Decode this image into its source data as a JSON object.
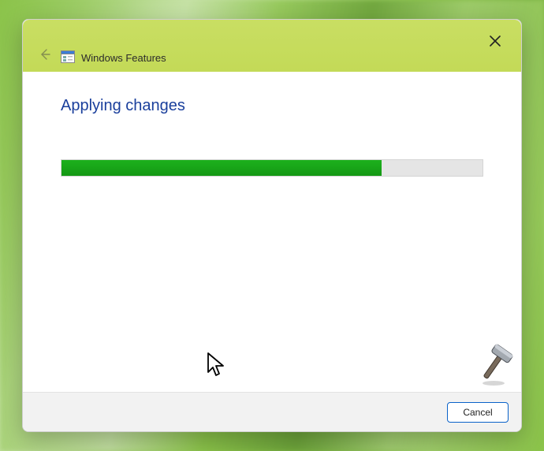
{
  "window": {
    "title": "Windows Features",
    "heading": "Applying changes",
    "progress_percent": 76
  },
  "footer": {
    "cancel_label": "Cancel"
  }
}
